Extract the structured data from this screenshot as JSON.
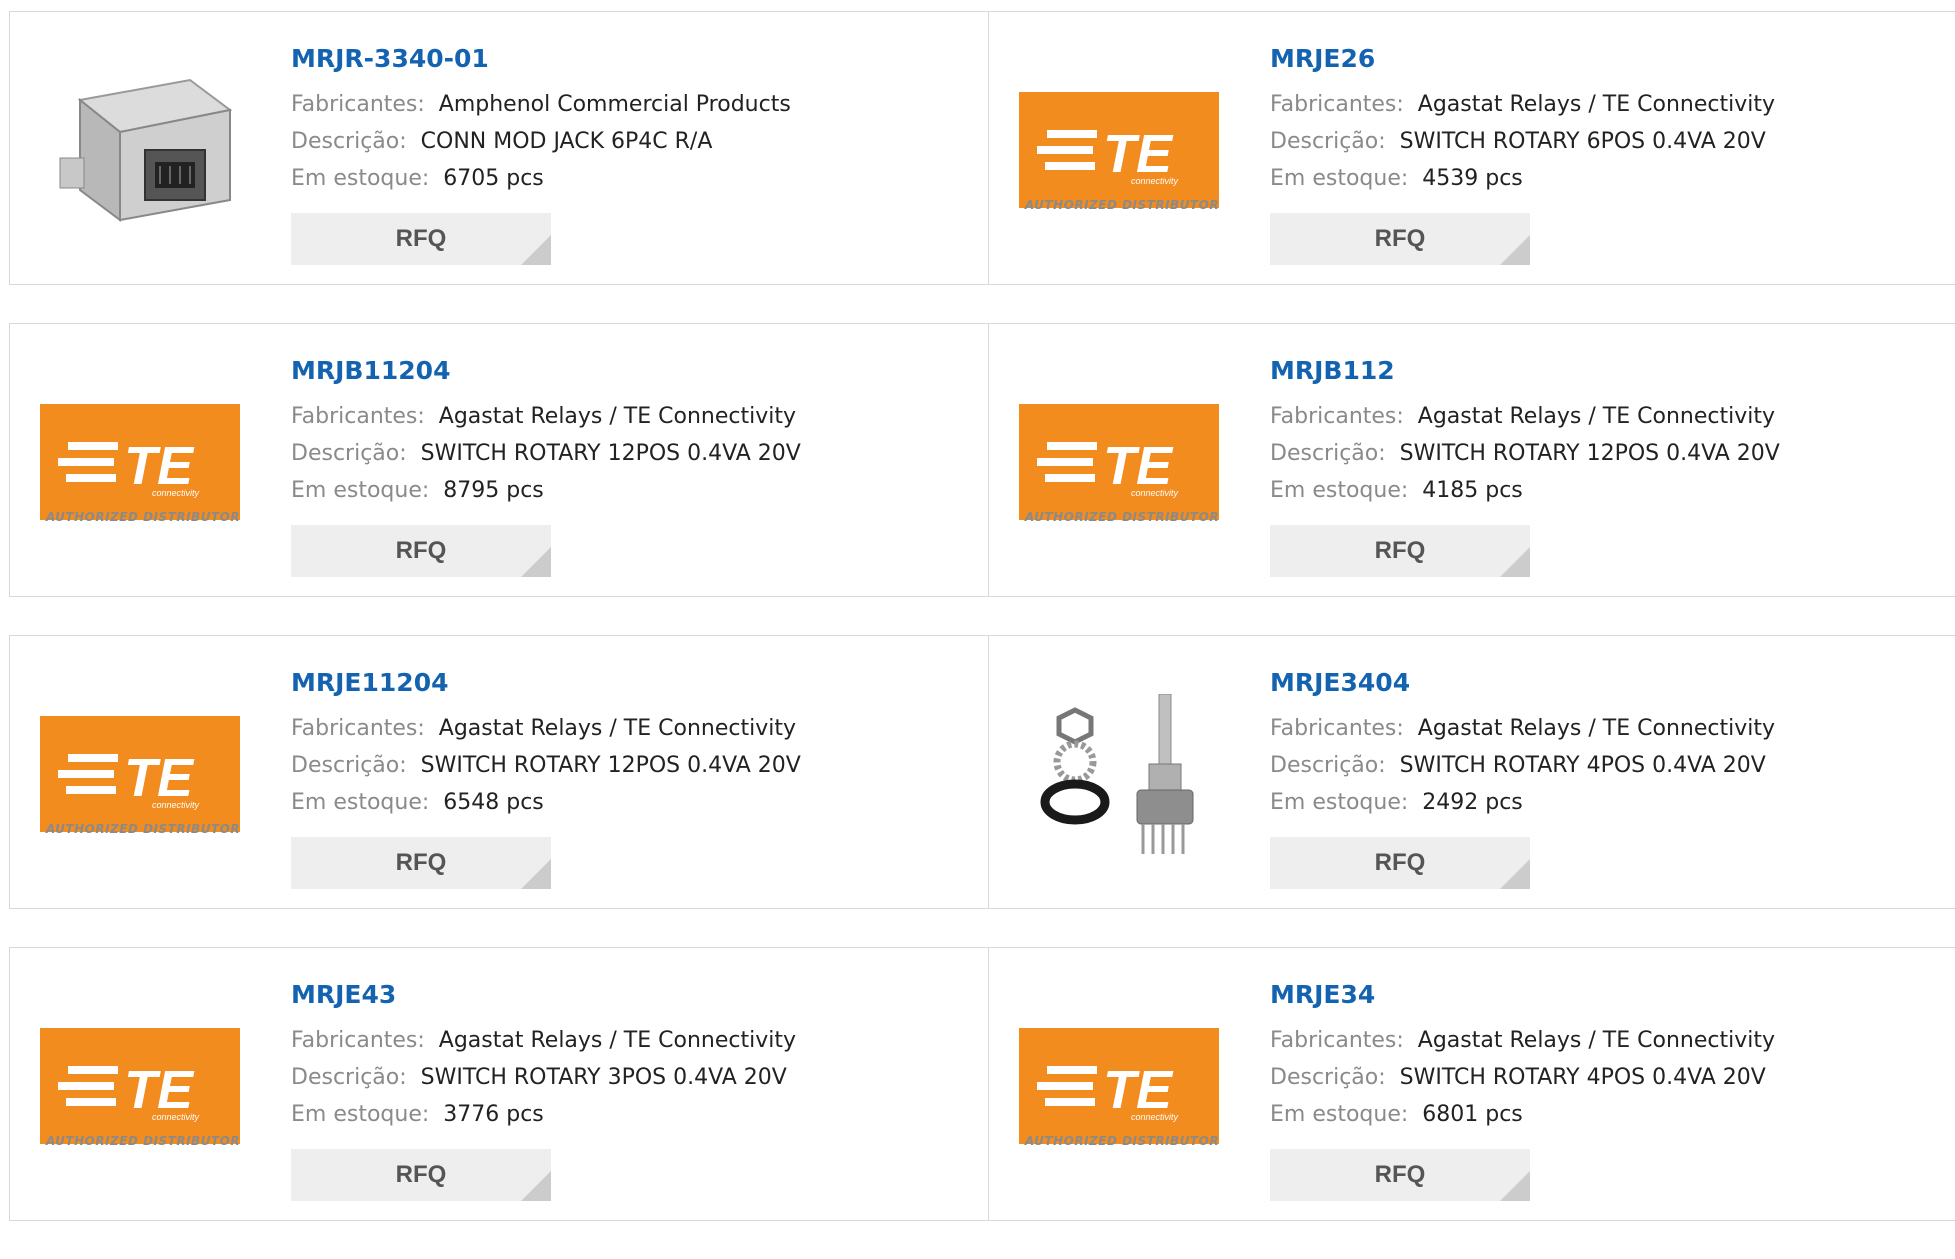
{
  "labels": {
    "manufacturer": "Fabricantes:",
    "description": "Descrição:",
    "stock": "Em estoque:",
    "rfq": "RFQ"
  },
  "te_logo": {
    "mark": "TE",
    "sub": "connectivity",
    "caption": "AUTHORIZED DISTRIBUTOR"
  },
  "colors": {
    "title": "#1463b0",
    "te_orange": "#f28c1e"
  },
  "products": [
    {
      "part": "MRJR-3340-01",
      "manufacturer": "Amphenol Commercial Products",
      "description": "CONN MOD JACK 6P4C R/A",
      "stock": "6705 pcs",
      "image": "rj-jack-photo"
    },
    {
      "part": "MRJE26",
      "manufacturer": "Agastat Relays / TE Connectivity",
      "description": "SWITCH ROTARY 6POS 0.4VA 20V",
      "stock": "4539 pcs",
      "image": "te-logo"
    },
    {
      "part": "MRJB11204",
      "manufacturer": "Agastat Relays / TE Connectivity",
      "description": "SWITCH ROTARY 12POS 0.4VA 20V",
      "stock": "8795 pcs",
      "image": "te-logo"
    },
    {
      "part": "MRJB112",
      "manufacturer": "Agastat Relays / TE Connectivity",
      "description": "SWITCH ROTARY 12POS 0.4VA 20V",
      "stock": "4185 pcs",
      "image": "te-logo"
    },
    {
      "part": "MRJE11204",
      "manufacturer": "Agastat Relays / TE Connectivity",
      "description": "SWITCH ROTARY 12POS 0.4VA 20V",
      "stock": "6548 pcs",
      "image": "te-logo"
    },
    {
      "part": "MRJE3404",
      "manufacturer": "Agastat Relays / TE Connectivity",
      "description": "SWITCH ROTARY 4POS 0.4VA 20V",
      "stock": "2492 pcs",
      "image": "rotary-switch-photo"
    },
    {
      "part": "MRJE43",
      "manufacturer": "Agastat Relays / TE Connectivity",
      "description": "SWITCH ROTARY 3POS 0.4VA 20V",
      "stock": "3776 pcs",
      "image": "te-logo"
    },
    {
      "part": "MRJE34",
      "manufacturer": "Agastat Relays / TE Connectivity",
      "description": "SWITCH ROTARY 4POS 0.4VA 20V",
      "stock": "6801 pcs",
      "image": "te-logo"
    }
  ]
}
